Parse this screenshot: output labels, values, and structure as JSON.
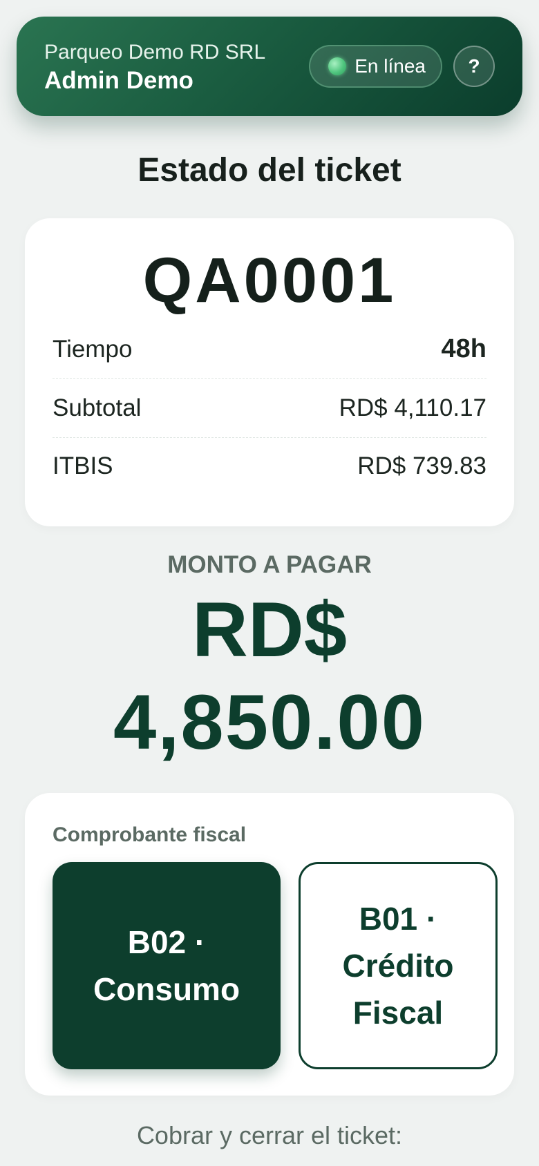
{
  "header": {
    "company": "Parqueo Demo RD SRL",
    "user": "Admin Demo",
    "status_label": "En línea",
    "help_label": "?"
  },
  "page_title": "Estado del ticket",
  "ticket": {
    "code": "QA0001",
    "rows": [
      {
        "label": "Tiempo",
        "value": "48h"
      },
      {
        "label": "Subtotal",
        "value": "RD$ 4,110.17"
      },
      {
        "label": "ITBIS",
        "value": "RD$ 739.83"
      }
    ]
  },
  "amount": {
    "label": "MONTO A PAGAR",
    "currency": "RD$",
    "value": "4,850.00"
  },
  "fiscal": {
    "label": "Comprobante fiscal",
    "options": [
      {
        "label": "B02 · Consumo",
        "selected": true
      },
      {
        "label": "B01 · Crédito Fiscal",
        "selected": false
      }
    ]
  },
  "footer": {
    "prompt": "Cobrar y cerrar el ticket:"
  },
  "colors": {
    "brand": "#0d3e2d",
    "background": "#eff2f1",
    "status_online": "#4fc57e"
  }
}
